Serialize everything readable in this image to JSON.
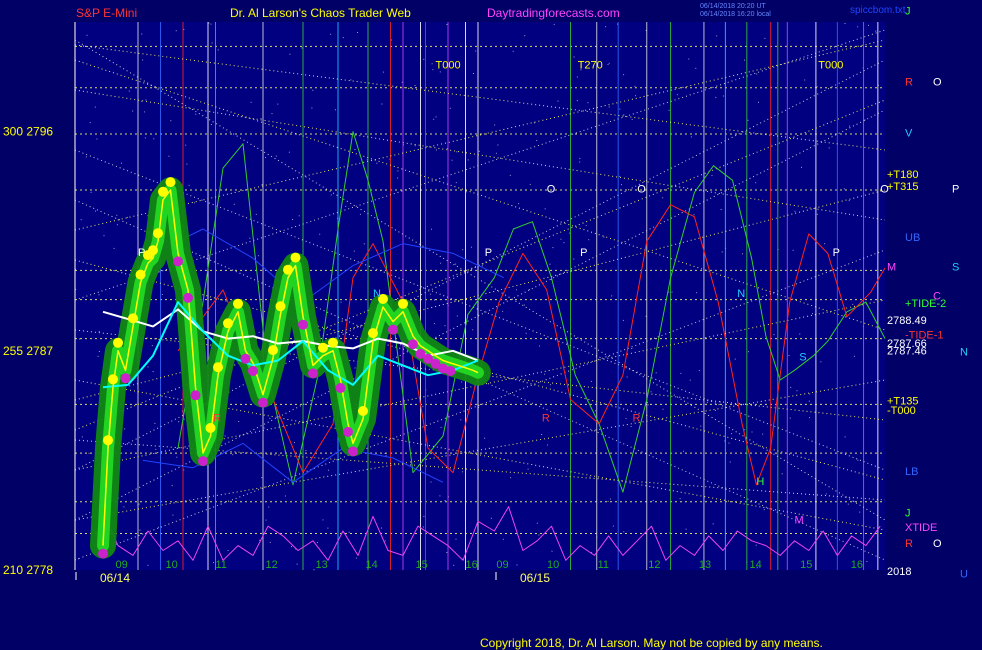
{
  "header": {
    "instrument": "S&P E-Mini",
    "site_title": "Dr. Al Larson's Chaos Trader Web",
    "site_url": "Daytradingforecasts.com",
    "stamp_line_1": "06/14/2018 20:20 UT",
    "stamp_line_2": "06/14/2018 16:20 local",
    "site_tag": "spiccbom.txt"
  },
  "footer": {
    "copyright": "Copyright 2018, Dr. Al Larson. May not be copied by any means."
  },
  "colors": {
    "background": "#000066",
    "plot_bg": "#000080",
    "price": "#ffff00",
    "avg_white": "#ffffff",
    "avg_cyan": "#00ffff",
    "flow_green": "#33cc33",
    "flow_red": "#ff2222",
    "flow_blue": "#2244ff",
    "xtide": "#ee44ee",
    "grid_yellow": "#ffff66",
    "grid_white": "#e0e0e0",
    "violet": "#cc44ff"
  },
  "chart_data": {
    "type": "line",
    "y_ticks": [
      {
        "label": "300  2796",
        "price": 2796
      },
      {
        "label": "255  2787",
        "price": 2787
      },
      {
        "label": "210  2778",
        "price": 2778
      }
    ],
    "ylim": [
      2778,
      2800.5
    ],
    "x_hours_day1": [
      "09",
      "10",
      "11",
      "12",
      "13",
      "14",
      "15",
      "16"
    ],
    "x_hours_day2": [
      "09",
      "10",
      "11",
      "12",
      "13",
      "14",
      "15",
      "16"
    ],
    "dates": [
      "06/14",
      "06/15"
    ],
    "series": [
      {
        "key": "price",
        "x": [
          0,
          0.1,
          0.2,
          0.3,
          0.45,
          0.6,
          0.75,
          0.9,
          1,
          1.1,
          1.2,
          1.35,
          1.5,
          1.7,
          1.85,
          2,
          2.15,
          2.3,
          2.5,
          2.7,
          2.85,
          3,
          3.2,
          3.4,
          3.55,
          3.7,
          3.85,
          4,
          4.2,
          4.4,
          4.6,
          4.75,
          4.9,
          5,
          5.2,
          5.4,
          5.6,
          5.8,
          6,
          6.2,
          6.35,
          6.5,
          6.65,
          6.8,
          6.95,
          7.1,
          7.25,
          7.4,
          7.5
        ],
        "y": [
          2779.0,
          2783.0,
          2785.5,
          2787.0,
          2786.2,
          2788.0,
          2789.8,
          2790.6,
          2790.8,
          2791.5,
          2793.2,
          2793.6,
          2791.0,
          2789.5,
          2785.5,
          2782.8,
          2783.5,
          2786.0,
          2787.8,
          2788.6,
          2787.0,
          2786.5,
          2785.2,
          2786.7,
          2788.5,
          2790.0,
          2790.5,
          2788.4,
          2786.4,
          2786.8,
          2787.0,
          2785.8,
          2784.0,
          2783.2,
          2784.2,
          2787.4,
          2788.8,
          2788.2,
          2788.6,
          2787.6,
          2787.2,
          2787.0,
          2786.8,
          2786.6,
          2786.5,
          2786.4,
          2786.3,
          2786.2,
          2786.1
        ]
      },
      {
        "key": "avg_white",
        "x": [
          0,
          0.5,
          1,
          1.5,
          2,
          2.5,
          3,
          3.5,
          4,
          4.5,
          5,
          5.5,
          6,
          6.5,
          7,
          7.5
        ],
        "y": [
          2788.6,
          2788.3,
          2788.0,
          2788.7,
          2787.8,
          2787.5,
          2787.6,
          2787.3,
          2787.4,
          2787.2,
          2787.1,
          2787.5,
          2787.3,
          2786.8,
          2787.0,
          2786.6
        ]
      },
      {
        "key": "avg_cyan",
        "x": [
          0,
          0.5,
          1,
          1.5,
          2,
          2.5,
          3,
          3.5,
          4,
          4.5,
          5,
          5.5,
          6,
          6.5,
          7,
          7.5
        ],
        "y": [
          2785.5,
          2785.6,
          2786.8,
          2789.0,
          2787.8,
          2786.8,
          2786.4,
          2786.6,
          2787.4,
          2786.2,
          2785.6,
          2786.8,
          2786.4,
          2786.0,
          2786.2,
          2786.6
        ]
      },
      {
        "key": "flow_green",
        "x": [
          1.5,
          2,
          2.4,
          2.8,
          3.3,
          3.8,
          4.3,
          4.7,
          5,
          5.3,
          5.6,
          6.2,
          6.8,
          7.3,
          7.8,
          8.2,
          8.6,
          9.0,
          9.5,
          10,
          10.5,
          11,
          11.5,
          12,
          12.4,
          12.8,
          13.2,
          13.5,
          13.8,
          14.1,
          14.5,
          14.8,
          15.2,
          15.6,
          16
        ],
        "y": [
          2783,
          2789,
          2794.5,
          2795.5,
          2786,
          2781.5,
          2786,
          2792,
          2796,
          2794,
          2791.5,
          2782,
          2783.5,
          2788.5,
          2790,
          2792.0,
          2792.3,
          2790.0,
          2786.0,
          2784.0,
          2781.2,
          2785.0,
          2790.0,
          2793.5,
          2794.6,
          2794.0,
          2790.8,
          2787.6,
          2785.8,
          2786.2,
          2786.8,
          2787.4,
          2788.6,
          2789.0,
          2787.5
        ]
      },
      {
        "key": "flow_red",
        "x": [
          1.5,
          2.4,
          2.9,
          3.4,
          4,
          4.6,
          5,
          5.4,
          6,
          6.5,
          7,
          7.5,
          7.9,
          8.4,
          8.9,
          9.4,
          10,
          10.5,
          11,
          11.5,
          12,
          12.5,
          13,
          13.3,
          13.6,
          14,
          14.4,
          14.8,
          15.2,
          15.7,
          16
        ],
        "y": [
          2787,
          2789.5,
          2787.0,
          2785.0,
          2782.0,
          2784.0,
          2790.0,
          2791.4,
          2789.0,
          2783.0,
          2782.0,
          2786.0,
          2789.0,
          2791.0,
          2789.5,
          2785.0,
          2784.0,
          2786.0,
          2791.5,
          2793.0,
          2792.5,
          2789.0,
          2784.0,
          2781.5,
          2783.0,
          2789.0,
          2791.8,
          2791.0,
          2788.4,
          2789.4,
          2790.4
        ]
      },
      {
        "key": "flow_blue",
        "x": [
          1.0,
          2.0,
          3.0,
          4.0,
          5.0,
          6.0,
          7.0,
          8.0
        ],
        "y": [
          2791.0,
          2792.0,
          2790.8,
          2789.0,
          2790.5,
          2791.4,
          2791.0,
          2790.0
        ]
      },
      {
        "key": "flow_blue",
        "x": [
          0.8,
          1.8,
          2.8,
          3.8,
          4.8,
          5.8,
          6.8
        ],
        "y": [
          2782.5,
          2782.2,
          2783.2,
          2781.6,
          2783.0,
          2782.6,
          2781.6
        ]
      },
      {
        "key": "xtide",
        "x": [
          0,
          0.3,
          0.6,
          0.9,
          1.2,
          1.5,
          1.8,
          2.1,
          2.4,
          2.7,
          3.0,
          3.3,
          3.6,
          3.9,
          4.2,
          4.5,
          4.8,
          5.1,
          5.4,
          5.7,
          6.0,
          6.3,
          6.6,
          6.9,
          7.2,
          7.5,
          7.8,
          8.1,
          8.4,
          8.7,
          9.0,
          9.3,
          9.6,
          9.9,
          10.2,
          10.5,
          10.8,
          11.1,
          11.4,
          11.7,
          12.0,
          12.3,
          12.6,
          12.9,
          13.2,
          13.5,
          13.8,
          14.1,
          14.4,
          14.7,
          15.0,
          15.3,
          15.6,
          15.9
        ],
        "y": [
          2780.4,
          2779.0,
          2778.6,
          2779.6,
          2778.8,
          2779.2,
          2778.4,
          2779.8,
          2778.4,
          2779.0,
          2778.6,
          2779.8,
          2779.4,
          2778.8,
          2779.2,
          2778.4,
          2779.6,
          2778.6,
          2780.2,
          2778.8,
          2778.6,
          2779.8,
          2779.4,
          2779.0,
          2778.4,
          2780.0,
          2779.6,
          2780.6,
          2778.8,
          2779.2,
          2779.8,
          2778.4,
          2779.0,
          2778.6,
          2779.4,
          2778.6,
          2779.2,
          2779.8,
          2778.4,
          2779.0,
          2778.6,
          2779.4,
          2778.8,
          2779.6,
          2779.2,
          2779.0,
          2778.6,
          2779.2,
          2778.8,
          2779.6,
          2778.6,
          2779.4,
          2779.0,
          2779.8
        ]
      }
    ],
    "annotations": [
      {
        "text": "T000",
        "x": 6.65,
        "y": 2798.6,
        "color": "#ffff00"
      },
      {
        "text": "T270",
        "x": 9.55,
        "y": 2798.6,
        "color": "#ffff00"
      },
      {
        "text": "T000",
        "x": 14.6,
        "y": 2798.6,
        "color": "#ffff00"
      },
      {
        "text": "P",
        "x": 0.7,
        "y": 2790.9,
        "color": "#ffffff"
      },
      {
        "text": "P",
        "x": 7.6,
        "y": 2790.9,
        "color": "#ffffff"
      },
      {
        "text": "P",
        "x": 9.6,
        "y": 2790.9,
        "color": "#ffffff"
      },
      {
        "text": "P",
        "x": 14.9,
        "y": 2790.9,
        "color": "#ffffff"
      },
      {
        "text": "O",
        "x": 8.9,
        "y": 2793.5,
        "color": "#ffffff"
      },
      {
        "text": "O",
        "x": 10.8,
        "y": 2793.5,
        "color": "#ffffff"
      },
      {
        "text": "O",
        "x": 15.9,
        "y": 2793.5,
        "color": "#ffffff"
      },
      {
        "text": "N",
        "x": 5.4,
        "y": 2789.2,
        "color": "#22ccff"
      },
      {
        "text": "N",
        "x": 12.9,
        "y": 2789.2,
        "color": "#22ccff"
      },
      {
        "text": "R",
        "x": 2.2,
        "y": 2784.1,
        "color": "#ff3333"
      },
      {
        "text": "R",
        "x": 8.8,
        "y": 2784.1,
        "color": "#ff3333"
      },
      {
        "text": "R",
        "x": 10.7,
        "y": 2784.1,
        "color": "#ff3333"
      },
      {
        "text": "H",
        "x": 13.3,
        "y": 2781.5,
        "color": "#33ff33"
      },
      {
        "text": "M",
        "x": 14.1,
        "y": 2779.9,
        "color": "#ff44ff"
      },
      {
        "text": "S",
        "x": 14.2,
        "y": 2786.6,
        "color": "#22ccff"
      }
    ],
    "right_labels": [
      {
        "text": "J",
        "y": 2800.8,
        "color": "#33ff33",
        "col": 1
      },
      {
        "text": "R",
        "y": 2797.9,
        "color": "#ff3333",
        "col": 1
      },
      {
        "text": "O",
        "y": 2797.9,
        "color": "#ffffff",
        "col": 2
      },
      {
        "text": "V",
        "y": 2795.8,
        "color": "#22ccff",
        "col": 1
      },
      {
        "text": "+T180",
        "y": 2794.1,
        "color": "#ffff00",
        "col": 0
      },
      {
        "text": "+T315",
        "y": 2793.6,
        "color": "#ffff00",
        "col": 0
      },
      {
        "text": "P",
        "y": 2793.5,
        "color": "#ffffff",
        "col": 3
      },
      {
        "text": "UB",
        "y": 2791.5,
        "color": "#3366ff",
        "col": 1
      },
      {
        "text": "M",
        "y": 2790.3,
        "color": "#ff44ff",
        "col": 0
      },
      {
        "text": "S",
        "y": 2790.3,
        "color": "#22ccff",
        "col": 3
      },
      {
        "text": "C",
        "y": 2789.1,
        "color": "#ff44ff",
        "col": 2
      },
      {
        "text": "+TIDE-2",
        "y": 2788.8,
        "color": "#33ff33",
        "col": 1
      },
      {
        "text": "2788.49",
        "y": 2788.1,
        "color": "#ffffff",
        "col": 0
      },
      {
        "text": "-TIDE-1",
        "y": 2787.5,
        "color": "#ff3333",
        "col": 1
      },
      {
        "text": "2787.66",
        "y": 2787.15,
        "color": "#ffffff",
        "col": 0
      },
      {
        "text": "2787.46",
        "y": 2786.85,
        "color": "#ffffff",
        "col": 0
      },
      {
        "text": "N",
        "y": 2786.8,
        "color": "#22ccff",
        "col": 4
      },
      {
        "text": "+T135",
        "y": 2784.8,
        "color": "#ffff00",
        "col": 0
      },
      {
        "text": "-T000",
        "y": 2784.4,
        "color": "#ffff00",
        "col": 0
      },
      {
        "text": "LB",
        "y": 2781.9,
        "color": "#3366ff",
        "col": 1
      },
      {
        "text": "J",
        "y": 2780.2,
        "color": "#33ff33",
        "col": 1
      },
      {
        "text": "XTIDE",
        "y": 2779.6,
        "color": "#ff44ff",
        "col": 1
      },
      {
        "text": "R",
        "y": 2778.95,
        "color": "#ff3333",
        "col": 1
      },
      {
        "text": "O",
        "y": 2778.95,
        "color": "#ffffff",
        "col": 2
      },
      {
        "text": "2018",
        "y": 2777.8,
        "color": "#ffffff",
        "col": 0
      },
      {
        "text": "U",
        "y": 2777.7,
        "color": "#3366ff",
        "col": 4
      }
    ]
  }
}
